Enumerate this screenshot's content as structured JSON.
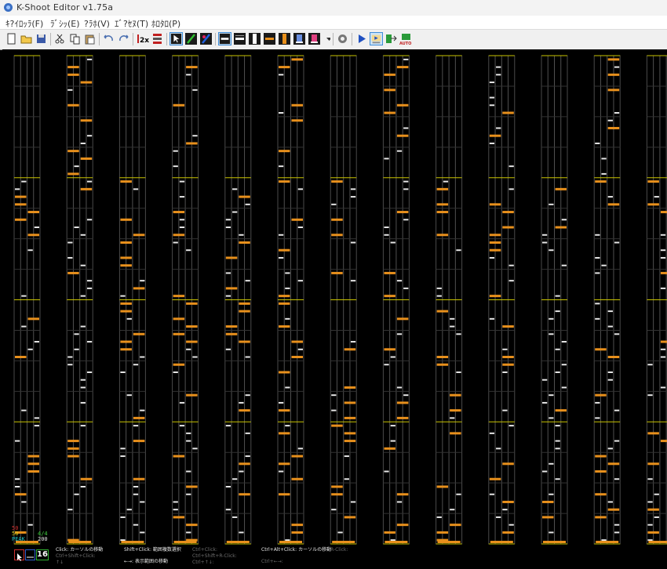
{
  "window": {
    "title": "K-Shoot Editor v1.75a"
  },
  "menu": [
    {
      "label": "ｷ?ｲﾛｯﾗ(F)"
    },
    {
      "label": "ﾗﾞｼｯ(E)"
    },
    {
      "label": "?ﾗﾎ(V)"
    },
    {
      "label": "ｴﾞ?ｾﾇ(T)"
    },
    {
      "label": "ﾎﾛﾀﾛ(P)"
    }
  ],
  "toolbar": {
    "buttons": [
      {
        "name": "new-file-icon",
        "kind": "new"
      },
      {
        "name": "open-folder-icon",
        "kind": "open"
      },
      {
        "name": "save-icon",
        "kind": "save"
      },
      {
        "sep": true
      },
      {
        "name": "cut-icon",
        "kind": "cut"
      },
      {
        "name": "copy-icon",
        "kind": "copy"
      },
      {
        "name": "paste-icon",
        "kind": "paste"
      },
      {
        "sep": true
      },
      {
        "name": "undo-icon",
        "kind": "undo"
      },
      {
        "name": "redo-icon",
        "kind": "redo"
      },
      {
        "sep": true
      },
      {
        "name": "speed-2x-icon",
        "kind": "x2"
      },
      {
        "name": "bpm-marker-icon",
        "kind": "bpm"
      },
      {
        "sep": true
      },
      {
        "name": "pointer-tool-icon",
        "kind": "pointer",
        "selected": true
      },
      {
        "name": "laser-green-tool-icon",
        "kind": "lasergreen"
      },
      {
        "name": "laser-blue-tool-icon",
        "kind": "laserblue"
      },
      {
        "sep": true
      },
      {
        "name": "chip-note-tool-icon",
        "kind": "chip",
        "selected": true
      },
      {
        "name": "long-note-tool-icon",
        "kind": "long"
      },
      {
        "name": "fx-chip-tool-icon",
        "kind": "fxchip"
      },
      {
        "name": "fx-long-tool-icon",
        "kind": "fxlong"
      },
      {
        "name": "fx-hold-tool-icon",
        "kind": "fxhold"
      },
      {
        "name": "effect-tool-icon",
        "kind": "effect"
      },
      {
        "name": "camera-tool-icon",
        "kind": "camera"
      },
      {
        "name": "tool-dropdown-icon",
        "kind": "dropdown"
      },
      {
        "sep": true
      },
      {
        "name": "settings-gear-icon",
        "kind": "gear"
      },
      {
        "sep": true
      },
      {
        "name": "play-icon",
        "kind": "play"
      },
      {
        "name": "play-from-cursor-icon",
        "kind": "playcursor",
        "selected": true
      },
      {
        "name": "export-icon",
        "kind": "export"
      },
      {
        "name": "auto-play-icon",
        "kind": "auto",
        "label": "AUTO"
      }
    ]
  },
  "chart": {
    "columns": 13,
    "accent_note": "#e8901c",
    "bar_line": "#c9c400",
    "chip_note": "#e8e8e8"
  },
  "status": {
    "speed": {
      "label": "50",
      "color": "#d03030"
    },
    "scroll": {
      "label": "50",
      "color": "#d8d020"
    },
    "peak": {
      "label": "PEAK",
      "color": "#20c8c8"
    },
    "beat": {
      "label": "4/4",
      "color": "#40d040"
    },
    "bpm": {
      "label": "200",
      "color": "#e0e0e0"
    },
    "quantize": "16"
  },
  "legend": [
    {
      "text": "Click: カーソルの移動",
      "bright": true
    },
    {
      "text": "Ctrl+Shift+Click:",
      "bright": false
    },
    {
      "text": "↑↓",
      "bright": false
    },
    {
      "text": "Shift+Click: 範囲複数選択",
      "bright": true
    },
    {
      "text": "←→: 表示範囲の移動",
      "bright": true
    },
    {
      "text": "Ctrl+Click:",
      "bright": false
    },
    {
      "text": "Ctrl+Shift+R-Click:",
      "bright": false
    },
    {
      "text": "Ctrl+↑↓:",
      "bright": false
    },
    {
      "text": "Ctrl+Alt+Click: カーソルの移動",
      "bright": true
    },
    {
      "text": "Ctrl+←→:",
      "bright": false
    },
    {
      "text": "R-Click:",
      "bright": false
    }
  ]
}
